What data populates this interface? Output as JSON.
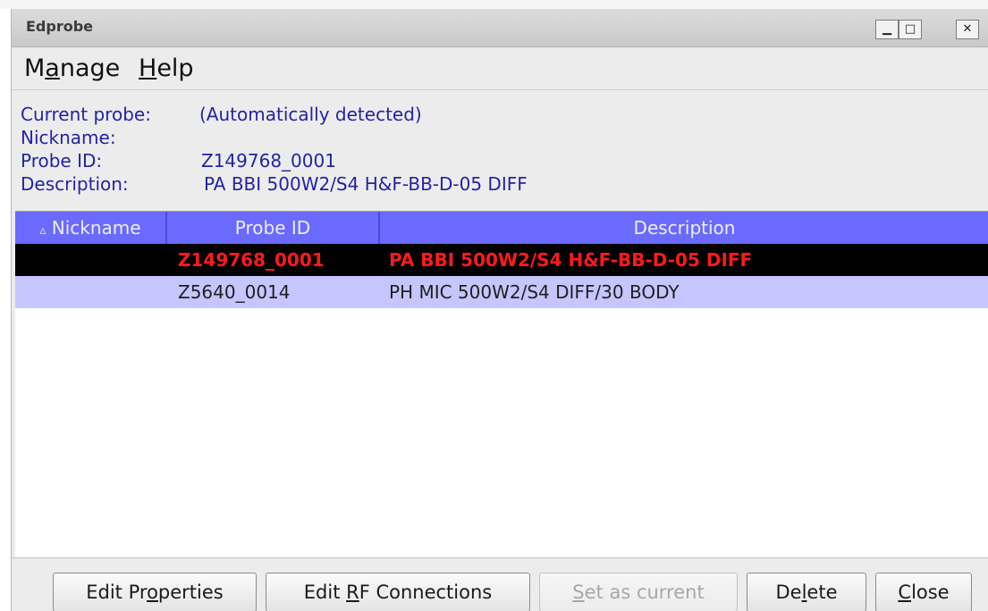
{
  "window": {
    "title": "Edprobe",
    "controls": {
      "minimize": "▁",
      "maximize": "□",
      "close": "✕"
    }
  },
  "menu": {
    "manage": {
      "pre": "M",
      "mnemonic": "a",
      "post": "nage"
    },
    "help": {
      "pre": "",
      "mnemonic": "H",
      "post": "elp"
    }
  },
  "info": {
    "current_probe_label": "Current probe:",
    "current_probe_value": "(Automatically detected)",
    "nickname_label": "Nickname:",
    "nickname_value": "",
    "probe_id_label": "Probe ID:",
    "probe_id_value": "Z149768_0001",
    "description_label": "Description:",
    "description_value": "PA BBI 500W2/S4 H&F-BB-D-05 DIFF"
  },
  "table": {
    "sort_indicator": "▵",
    "columns": [
      "Nickname",
      "Probe ID",
      "Description"
    ],
    "rows": [
      {
        "nickname": "",
        "probe_id": "Z149768_0001",
        "description": "PA BBI 500W2/S4 H&F-BB-D-05 DIFF",
        "state": "selected"
      },
      {
        "nickname": "",
        "probe_id": "Z5640_0014",
        "description": "PH MIC 500W2/S4 DIFF/30 BODY",
        "state": "normal"
      }
    ]
  },
  "buttons": {
    "edit_properties": {
      "pre": "Edit Pr",
      "mnemonic": "o",
      "post": "perties"
    },
    "edit_rf": {
      "pre": "Edit ",
      "mnemonic": "R",
      "post": "F Connections"
    },
    "set_current": {
      "pre": "",
      "mnemonic": "S",
      "post": "et as current",
      "disabled": true
    },
    "delete": {
      "pre": "De",
      "mnemonic": "l",
      "post": "ete"
    },
    "close": {
      "pre": "",
      "mnemonic": "C",
      "post": "lose"
    }
  },
  "colors": {
    "header_bg": "#6a6aff",
    "selected_row_bg": "#000000",
    "selected_row_text": "#ff1a1a",
    "alt_row_bg": "#c6c6ff",
    "info_text": "#2323a6"
  }
}
